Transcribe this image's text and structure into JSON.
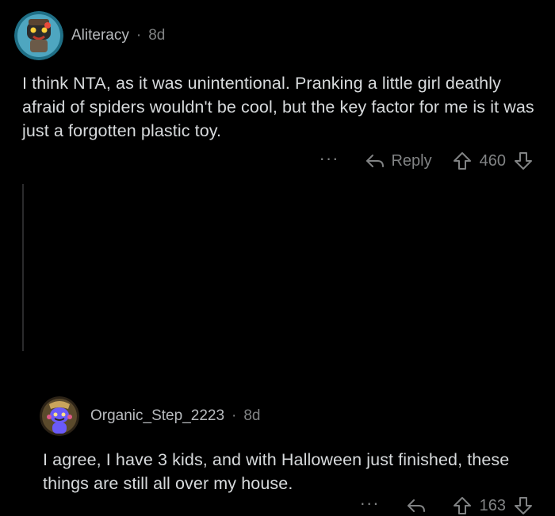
{
  "comments": [
    {
      "username": "Aliteracy",
      "separator": "·",
      "age": "8d",
      "body": "I think NTA, as it was unintentional. Pranking a little girl deathly afraid of spiders wouldn't be cool, but the key factor for me is it was just a forgotten plastic toy.",
      "more_label": "···",
      "reply_label": "Reply",
      "score": "460"
    },
    {
      "username": "Organic_Step_2223",
      "separator": "·",
      "age": "8d",
      "body": "I agree, I have 3 kids, and with Halloween just finished, these things are still all over my house.",
      "more_label": "···",
      "score": "163"
    }
  ],
  "colors": {
    "background": "#000000",
    "text": "#d7dadc",
    "muted": "#818384",
    "avatar1_accent": "#3f8fa8",
    "avatar2_accent": "#6a5af9"
  },
  "icons": [
    "reply-arrow-icon",
    "upvote-arrow-icon",
    "downvote-arrow-icon",
    "more-dots-icon"
  ]
}
